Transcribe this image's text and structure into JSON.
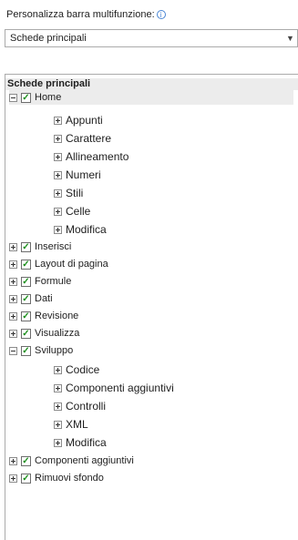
{
  "customize_label": "Personalizza barra multifunzione:",
  "combo": {
    "value": "Schede principali"
  },
  "tree": {
    "header": "Schede principali",
    "home": {
      "label": "Home",
      "checked": true,
      "expanded": true,
      "groups": [
        "Appunti",
        "Carattere",
        "Allineamento",
        "Numeri",
        "Stili",
        "Celle",
        "Modifica"
      ]
    },
    "tabs_a": [
      {
        "label": "Inserisci",
        "checked": true
      },
      {
        "label": "Layout di pagina",
        "checked": true
      },
      {
        "label": "Formule",
        "checked": true
      },
      {
        "label": "Dati",
        "checked": true
      },
      {
        "label": "Revisione",
        "checked": true
      },
      {
        "label": "Visualizza",
        "checked": true
      }
    ],
    "sviluppo": {
      "label": "Sviluppo",
      "checked": true,
      "expanded": true,
      "groups": [
        "Codice",
        "Componenti aggiuntivi",
        "Controlli",
        "XML",
        "Modifica"
      ]
    },
    "tabs_b": [
      {
        "label": "Componenti aggiuntivi",
        "checked": true
      },
      {
        "label": "Rimuovi sfondo",
        "checked": true
      }
    ]
  },
  "icons": {
    "info": "info-icon",
    "dropdown": "chevron-down-icon",
    "expand": "plus-box-icon",
    "collapse": "minus-box-icon",
    "check": "check-icon"
  }
}
